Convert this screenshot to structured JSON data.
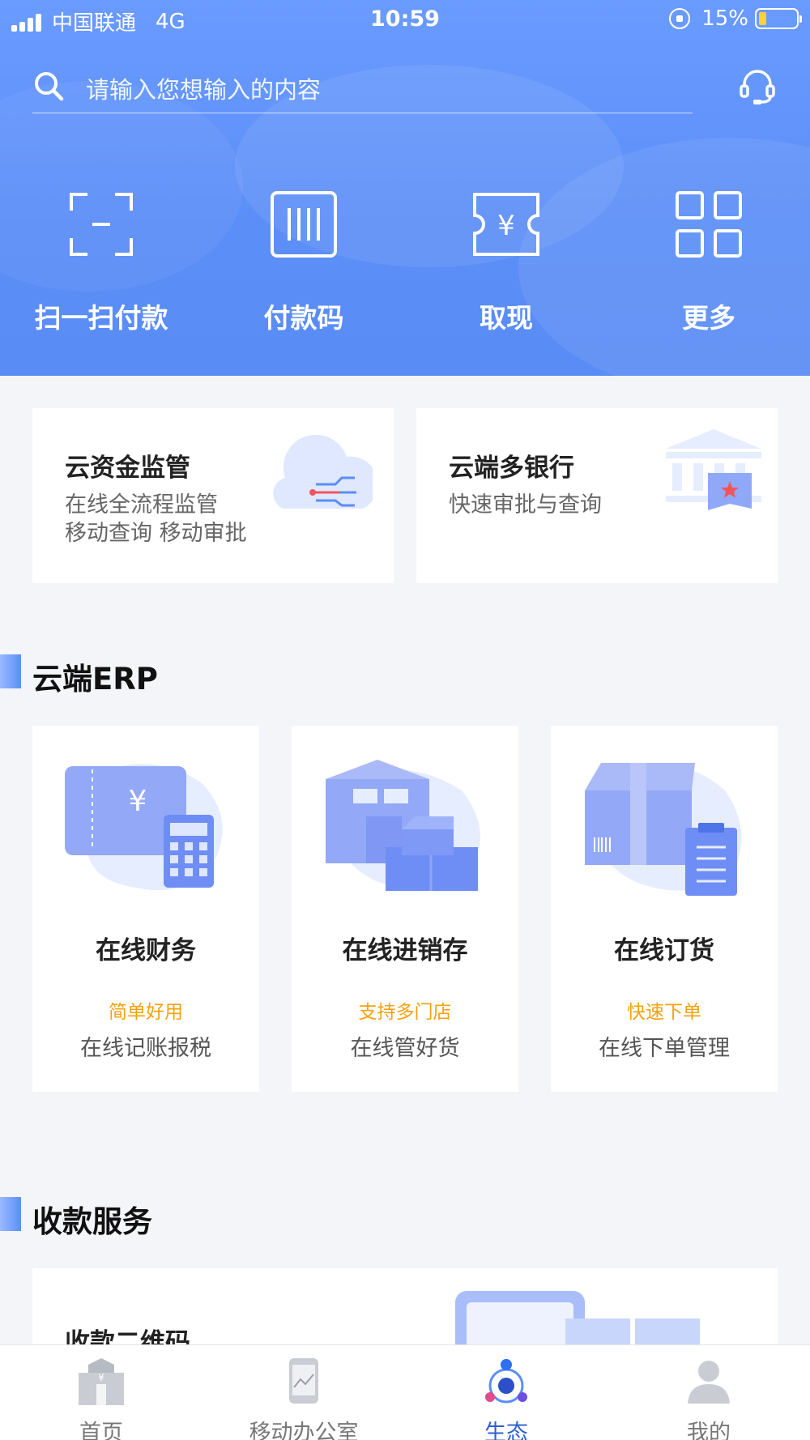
{
  "status_bar": {
    "carrier": "中国联通",
    "network": "4G",
    "time": "10:59",
    "battery": "15%"
  },
  "search": {
    "placeholder": "请输入您想输入的内容"
  },
  "quick_actions": [
    {
      "label": "扫一扫付款",
      "icon": "scan-icon"
    },
    {
      "label": "付款码",
      "icon": "barcode-icon"
    },
    {
      "label": "取现",
      "icon": "cash-ticket-icon"
    },
    {
      "label": "更多",
      "icon": "grid-icon"
    }
  ],
  "services": [
    {
      "title": "云资金监管",
      "desc_lines": [
        "在线全流程监管",
        "移动查询 移动审批"
      ]
    },
    {
      "title": "云端多银行",
      "desc_lines": [
        "快速审批与查询"
      ]
    }
  ],
  "erp_section": {
    "title": "云端ERP",
    "cards": [
      {
        "title": "在线财务",
        "tag": "简单好用",
        "desc": "在线记账报税"
      },
      {
        "title": "在线进销存",
        "tag": "支持多门店",
        "desc": "在线管好货"
      },
      {
        "title": "在线订货",
        "tag": "快速下单",
        "desc": "在线下单管理"
      }
    ]
  },
  "payment_section": {
    "title": "收款服务",
    "card_title": "收款二维码"
  },
  "tabs": [
    {
      "label": "首页",
      "active": false
    },
    {
      "label": "移动办公室",
      "active": false
    },
    {
      "label": "生态",
      "active": true
    },
    {
      "label": "我的",
      "active": false
    }
  ],
  "colors": {
    "header_blue": "#5b8ef7",
    "accent_orange": "#f5a20e",
    "active_tab": "#2f5fd6"
  }
}
